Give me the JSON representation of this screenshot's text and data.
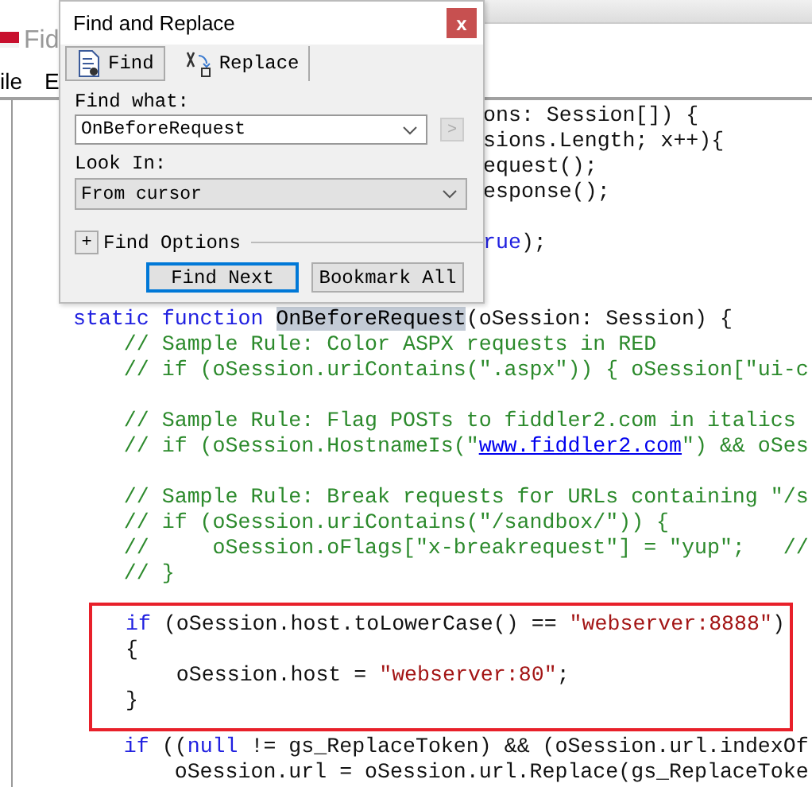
{
  "app": {
    "title": "Fid",
    "menu": [
      "ile",
      "E"
    ]
  },
  "code": {
    "before": [
      {
        "kind": "partial",
        "tokens": [
          {
            "kind": "text",
            "text": "ons: Session[]) {"
          }
        ]
      },
      {
        "kind": "partial",
        "tokens": [
          {
            "kind": "text",
            "text": "sions.Length; x++){"
          }
        ]
      },
      {
        "kind": "partial",
        "tokens": [
          {
            "kind": "text",
            "text": "equest();"
          }
        ]
      },
      {
        "kind": "partial",
        "tokens": [
          {
            "kind": "text",
            "text": "esponse();"
          }
        ]
      },
      {
        "kind": "blank"
      },
      {
        "kind": "partial",
        "tokens": [
          {
            "kind": "keyword",
            "text": "rue"
          },
          {
            "kind": "text",
            "text": ");"
          }
        ]
      },
      {
        "kind": "blank"
      },
      {
        "kind": "blank"
      },
      {
        "kind": "full",
        "tokens": [
          {
            "kind": "keyword",
            "text": "static function "
          },
          {
            "kind": "match",
            "text": "OnBeforeRequest"
          },
          {
            "kind": "text",
            "text": "(oSession: Session) {"
          }
        ]
      },
      {
        "kind": "full",
        "tokens": [
          {
            "kind": "comment",
            "text": "    // Sample Rule: Color ASPX requests in RED"
          }
        ]
      },
      {
        "kind": "full",
        "tokens": [
          {
            "kind": "comment",
            "text": "    // if (oSession.uriContains(\".aspx\")) { oSession[\"ui-c"
          }
        ]
      },
      {
        "kind": "blank"
      },
      {
        "kind": "full",
        "tokens": [
          {
            "kind": "comment",
            "text": "    // Sample Rule: Flag POSTs to fiddler2.com in italics"
          }
        ]
      },
      {
        "kind": "full",
        "tokens": [
          {
            "kind": "comment",
            "text": "    // if (oSession.HostnameIs(\""
          },
          {
            "kind": "link",
            "text": "www.fiddler2.com"
          },
          {
            "kind": "comment",
            "text": "\") && oSes"
          }
        ]
      },
      {
        "kind": "blank"
      },
      {
        "kind": "full",
        "tokens": [
          {
            "kind": "comment",
            "text": "    // Sample Rule: Break requests for URLs containing \"/s"
          }
        ]
      },
      {
        "kind": "full",
        "tokens": [
          {
            "kind": "comment",
            "text": "    // if (oSession.uriContains(\"/sandbox/\")) {"
          }
        ]
      },
      {
        "kind": "full",
        "tokens": [
          {
            "kind": "comment",
            "text": "    //     oSession.oFlags[\"x-breakrequest\"] = \"yup\";   //"
          }
        ]
      },
      {
        "kind": "full",
        "tokens": [
          {
            "kind": "comment",
            "text": "    // }"
          }
        ]
      }
    ],
    "boxed": [
      {
        "tokens": [
          {
            "kind": "keyword",
            "text": "if"
          },
          {
            "kind": "text",
            "text": " (oSession.host.toLowerCase() == "
          },
          {
            "kind": "string",
            "text": "\"webserver:8888\""
          },
          {
            "kind": "text",
            "text": ")"
          }
        ]
      },
      {
        "tokens": [
          {
            "kind": "text",
            "text": "{"
          }
        ]
      },
      {
        "tokens": [
          {
            "kind": "text",
            "text": "    oSession.host = "
          },
          {
            "kind": "string",
            "text": "\"webserver:80\""
          },
          {
            "kind": "text",
            "text": ";"
          }
        ]
      },
      {
        "tokens": [
          {
            "kind": "text",
            "text": "}"
          }
        ]
      }
    ],
    "after": [
      {
        "tokens": [
          {
            "kind": "keyword",
            "text": "    if"
          },
          {
            "kind": "text",
            "text": " (("
          },
          {
            "kind": "keyword",
            "text": "null"
          },
          {
            "kind": "text",
            "text": " != gs_ReplaceToken) && (oSession.url.indexOf"
          }
        ]
      },
      {
        "tokens": [
          {
            "kind": "text",
            "text": "        oSession.url = oSession.url.Replace(gs_ReplaceToke"
          }
        ]
      }
    ]
  },
  "dialog": {
    "title": "Find and Replace",
    "close": "x",
    "tabs": [
      {
        "label": "Find",
        "selected": true
      },
      {
        "label": "Replace",
        "selected": false
      }
    ],
    "find_what": {
      "label": "Find what:",
      "value": "OnBeforeRequest"
    },
    "next_arrow": {
      "label": ">",
      "disabled": true
    },
    "look_in": {
      "label": "Look In:",
      "value": "From cursor"
    },
    "options": {
      "toggle": "+",
      "label": "Find Options",
      "expanded": false
    },
    "buttons": [
      {
        "label": "Find Next",
        "default": true
      },
      {
        "label": "Bookmark All",
        "default": false
      }
    ]
  }
}
